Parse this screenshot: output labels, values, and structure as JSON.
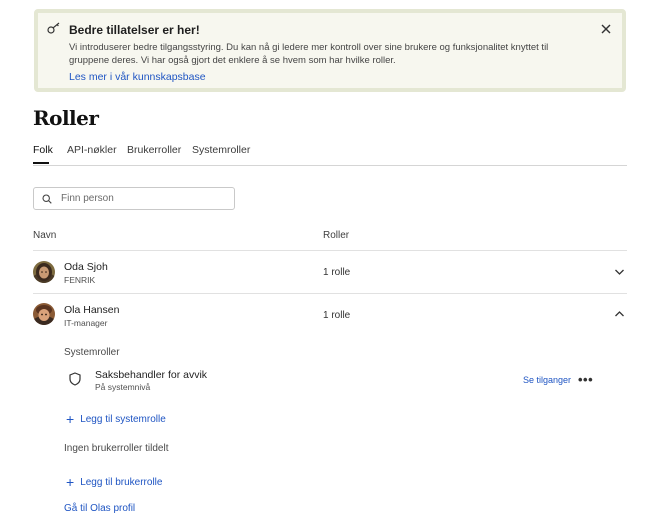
{
  "banner": {
    "title": "Bedre tillatelser er her!",
    "text": "Vi introduserer bedre tilgangsstyring. Du kan nå gi ledere mer kontroll over sine brukere og funksjonalitet knyttet til gruppene deres. Vi har også gjort det enklere å se hvem som har hvilke roller.",
    "link": "Les mer i vår kunnskapsbase"
  },
  "page": {
    "title": "Roller"
  },
  "tabs": [
    "Folk",
    "API-nøkler",
    "Brukerroller",
    "Systemroller"
  ],
  "search": {
    "placeholder": "Finn person",
    "value": ""
  },
  "table": {
    "col_name": "Navn",
    "col_roles": "Roller"
  },
  "people": [
    {
      "name": "Oda Sjoh",
      "subtitle": "FENRIK",
      "roles": "1 rolle",
      "expanded": false
    },
    {
      "name": "Ola Hansen",
      "subtitle": "IT-manager",
      "roles": "1 rolle",
      "expanded": true
    }
  ],
  "expanded": {
    "system_roles_label": "Systemroller",
    "role": {
      "name": "Saksbehandler for avvik",
      "level": "På systemnivå"
    },
    "see_access": "Se tilganger",
    "more": "•••",
    "add_system_role": "Legg til systemrolle",
    "no_user_roles": "Ingen brukerroller tildelt",
    "add_user_role": "Legg til brukerrolle",
    "profile_link": "Gå til Olas profil"
  },
  "icons": {
    "plus": "+"
  },
  "colors": {
    "link": "#1f55c3",
    "banner_bg": "#f7f7ef",
    "banner_border": "#e4e7d3"
  }
}
